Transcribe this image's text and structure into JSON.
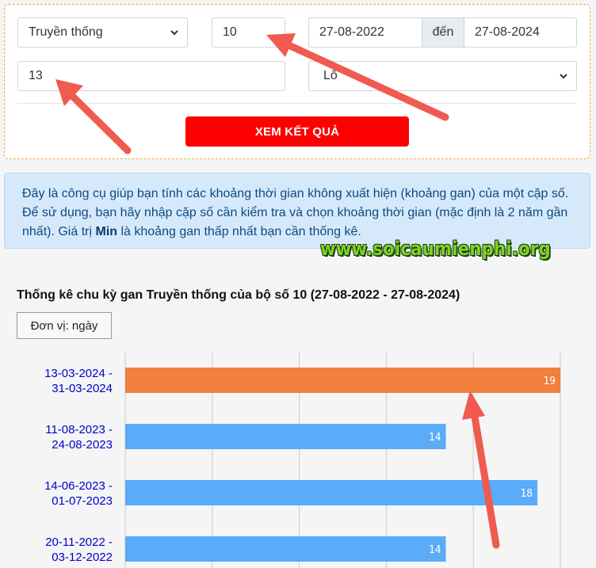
{
  "form": {
    "type_select": "Truyền thống",
    "number_input": "10",
    "date_from": "27-08-2022",
    "date_sep": "đến",
    "date_to": "27-08-2024",
    "min_input": "13",
    "mode_select": "Lô",
    "submit_label": "XEM KẾT QUẢ"
  },
  "info": {
    "text_before": "Đây là công cụ giúp bạn tính các khoảng thời gian không xuất hiện (khoảng gan) của một cặp số. Để sử dụng, bạn hãy nhập cặp số cần kiểm tra và chọn khoảng thời gian (mặc định là 2 năm gần nhất). Giá trị ",
    "bold": "Min",
    "text_after": " là khoảng gan thấp nhất bạn cần thống kê."
  },
  "watermark": "www.soicaumienphi.org",
  "chart": {
    "title": "Thống kê chu kỳ gan Truyền thống của bộ số 10 (27-08-2022 - 27-08-2024)",
    "unit_button": "Đơn vị: ngày"
  },
  "colors": {
    "highlight_bar": "#f0803c",
    "normal_bar": "#5aabf8",
    "label_link": "#0000cc",
    "submit": "#ff0000",
    "arrow": "#f05a4f"
  },
  "chart_data": {
    "type": "bar",
    "orientation": "horizontal",
    "categories": [
      [
        "13-03-2024 -",
        "31-03-2024"
      ],
      [
        "11-08-2023 -",
        "24-08-2023"
      ],
      [
        "14-06-2023 -",
        "01-07-2023"
      ],
      [
        "20-11-2022 -",
        "03-12-2022"
      ]
    ],
    "values": [
      19,
      14,
      18,
      14
    ],
    "highlight_index": 0,
    "xlim": [
      0,
      19
    ],
    "grid": true
  }
}
